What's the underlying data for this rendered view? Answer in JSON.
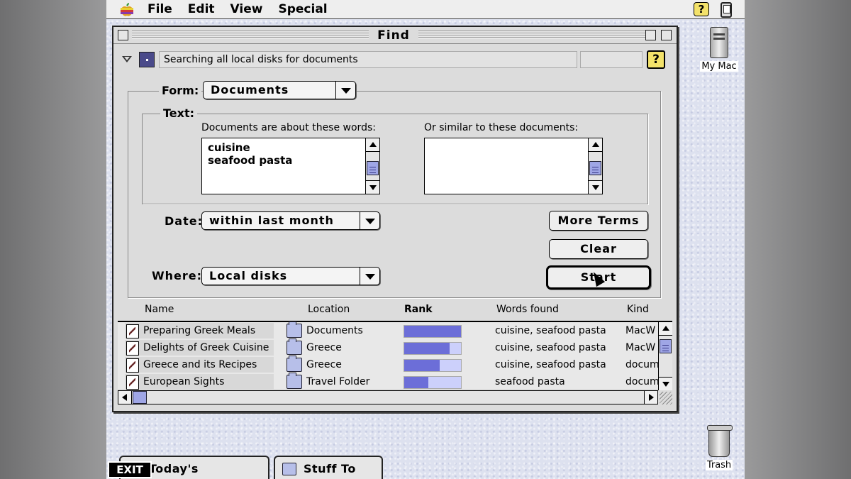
{
  "menubar": {
    "items": [
      "File",
      "Edit",
      "View",
      "Special"
    ],
    "help_glyph": "?"
  },
  "window": {
    "title": "Find",
    "status_text": "Searching all local disks for documents",
    "help_glyph": "?"
  },
  "form": {
    "label": "Form:",
    "value": "Documents"
  },
  "text_group": {
    "label": "Text:",
    "about_label": "Documents are about these words:",
    "about_lines": [
      "cuisine",
      "seafood pasta"
    ],
    "similar_label": "Or similar to these documents:"
  },
  "date": {
    "label": "Date:",
    "value": "within last month"
  },
  "where": {
    "label": "Where:",
    "value": "Local disks"
  },
  "buttons": {
    "more_terms": "More Terms",
    "clear": "Clear",
    "start": "Start"
  },
  "results": {
    "columns": [
      "Name",
      "Location",
      "Rank",
      "Words found",
      "Kind"
    ],
    "rows": [
      {
        "name": "Preparing Greek Meals",
        "location": "Documents",
        "rank": 1.0,
        "words": "cuisine, seafood pasta",
        "kind": "MacW"
      },
      {
        "name": "Delights of Greek Cuisine",
        "location": "Greece",
        "rank": 0.8,
        "words": "cuisine, seafood pasta",
        "kind": "MacW"
      },
      {
        "name": "Greece and its Recipes",
        "location": "Greece",
        "rank": 0.62,
        "words": "cuisine, seafood pasta",
        "kind": "docum"
      },
      {
        "name": "European Sights",
        "location": "Travel Folder",
        "rank": 0.43,
        "words": "seafood pasta",
        "kind": "docum"
      }
    ]
  },
  "desktop": {
    "my_mac": "My Mac",
    "trash": "Trash"
  },
  "tabs": {
    "todays_documents": "Today's Documents",
    "stuff_to_file": "Stuff To File",
    "exit": "EXIT"
  },
  "colors": {
    "rank_fill": "#6c6ed8",
    "rank_track": "#ccd0fb",
    "help_yellow": "#f3e26a",
    "desktop": "#dde1ef"
  }
}
